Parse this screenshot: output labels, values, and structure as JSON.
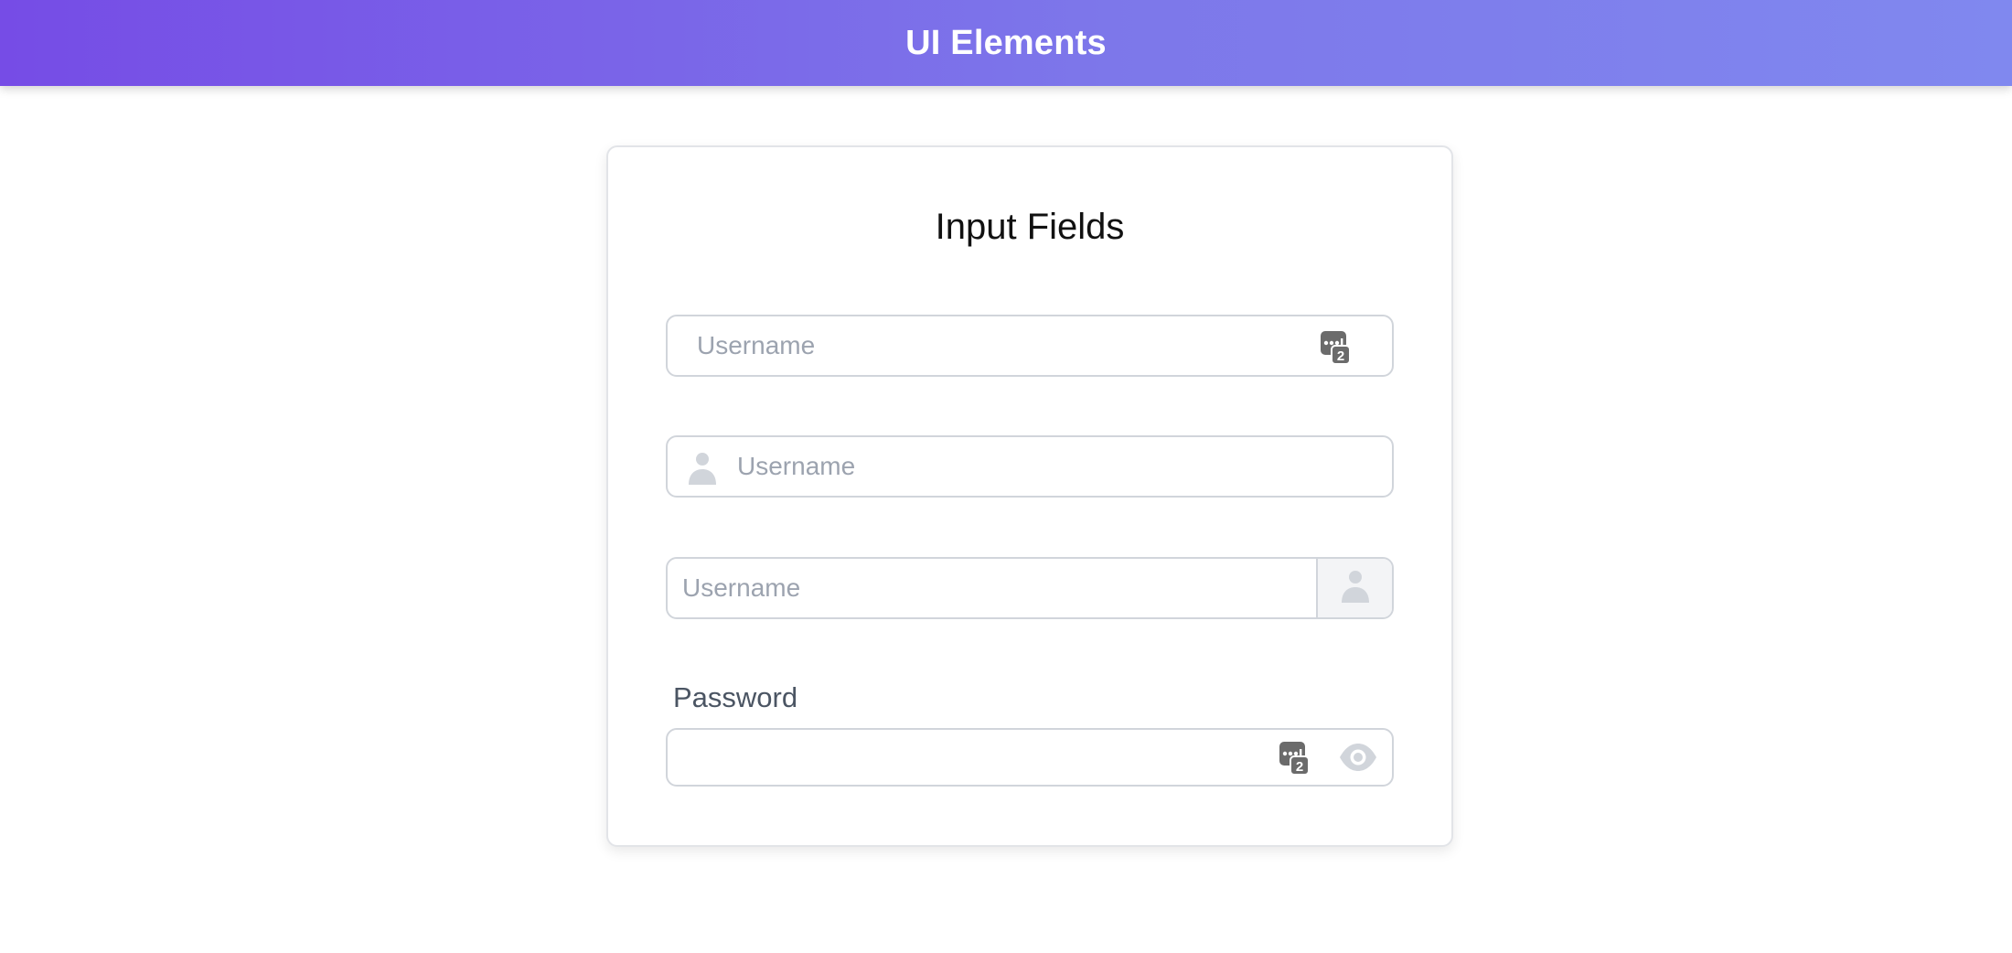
{
  "header": {
    "title": "UI Elements"
  },
  "card": {
    "title": "Input Fields",
    "fields": [
      {
        "placeholder": "Username",
        "value": "",
        "trailing_icon": "password-manager-icon"
      },
      {
        "placeholder": "Username",
        "value": "",
        "leading_icon": "user-icon"
      },
      {
        "placeholder": "Username",
        "value": "",
        "addon_icon": "user-icon"
      }
    ],
    "password": {
      "label": "Password",
      "value": "",
      "icons": [
        "password-manager-icon",
        "eye-icon"
      ]
    }
  },
  "colors": {
    "header_gradient_start": "#764ce6",
    "header_gradient_end": "#8088ef",
    "border": "#d1d5db",
    "placeholder": "#9ca3af",
    "icon_gray": "#d1d5db"
  }
}
